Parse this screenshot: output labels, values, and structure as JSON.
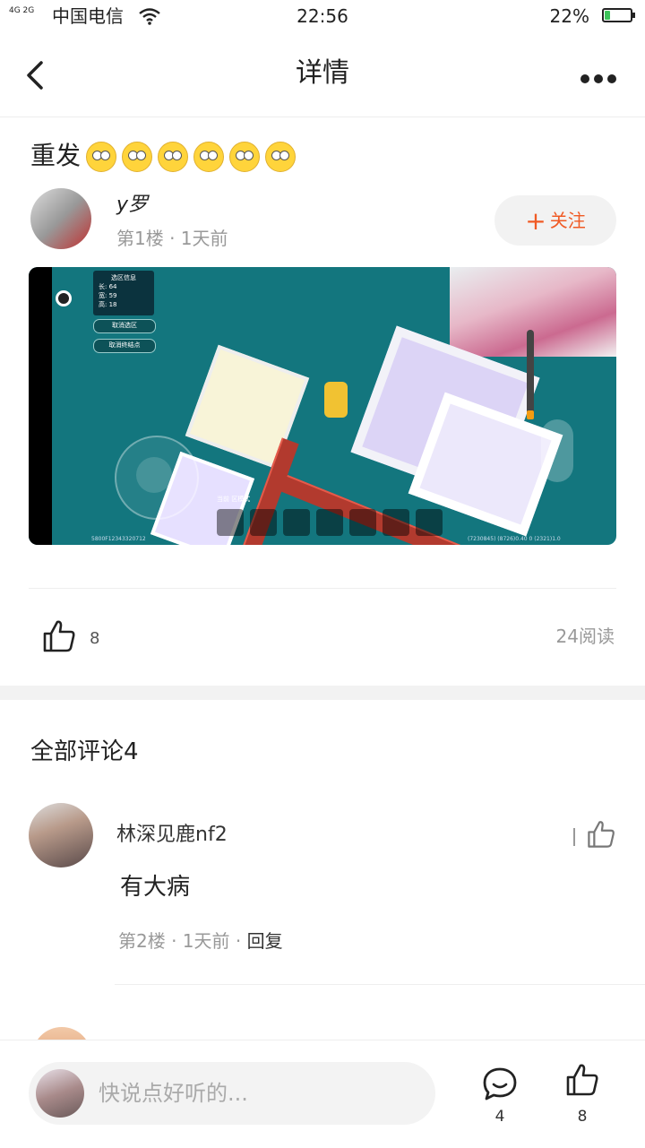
{
  "status_bar": {
    "network": "4G 2G",
    "carrier": "中国电信",
    "time": "22:56",
    "battery_percent": "22%",
    "battery_level": 0.22
  },
  "nav": {
    "title": "详情",
    "back_icon": "chevron-left-icon",
    "more_icon": "more-dots-icon"
  },
  "post": {
    "title": "重发",
    "emoji_count": 6,
    "author": {
      "name": "y罗",
      "meta": "第1楼 · 1天前"
    },
    "follow_label": "关注",
    "image_texts": {
      "panel_title": "选区信息",
      "panel_l": "长:   64",
      "panel_w": "宽:   59",
      "panel_h": "高:   18",
      "btn1": "取消选区",
      "btn2": "取消终结点",
      "mode": "当前   区模式",
      "footer_left": "5800F12343320712",
      "footer_right": "(7230845)   (8726)0.40 0   (2321)1.0"
    },
    "likes": "8",
    "reads": "24阅读"
  },
  "comments": {
    "heading": "全部评论4",
    "items": [
      {
        "name": "林深见鹿nf2",
        "body": "有大病",
        "meta": "第2楼 · 1天前 · ",
        "reply": "回复"
      }
    ]
  },
  "bottom_bar": {
    "input_placeholder": "快说点好听的...",
    "comment_count": "4",
    "like_count": "8"
  },
  "colors": {
    "accent": "#f05a24",
    "battery": "#3cc35a"
  }
}
